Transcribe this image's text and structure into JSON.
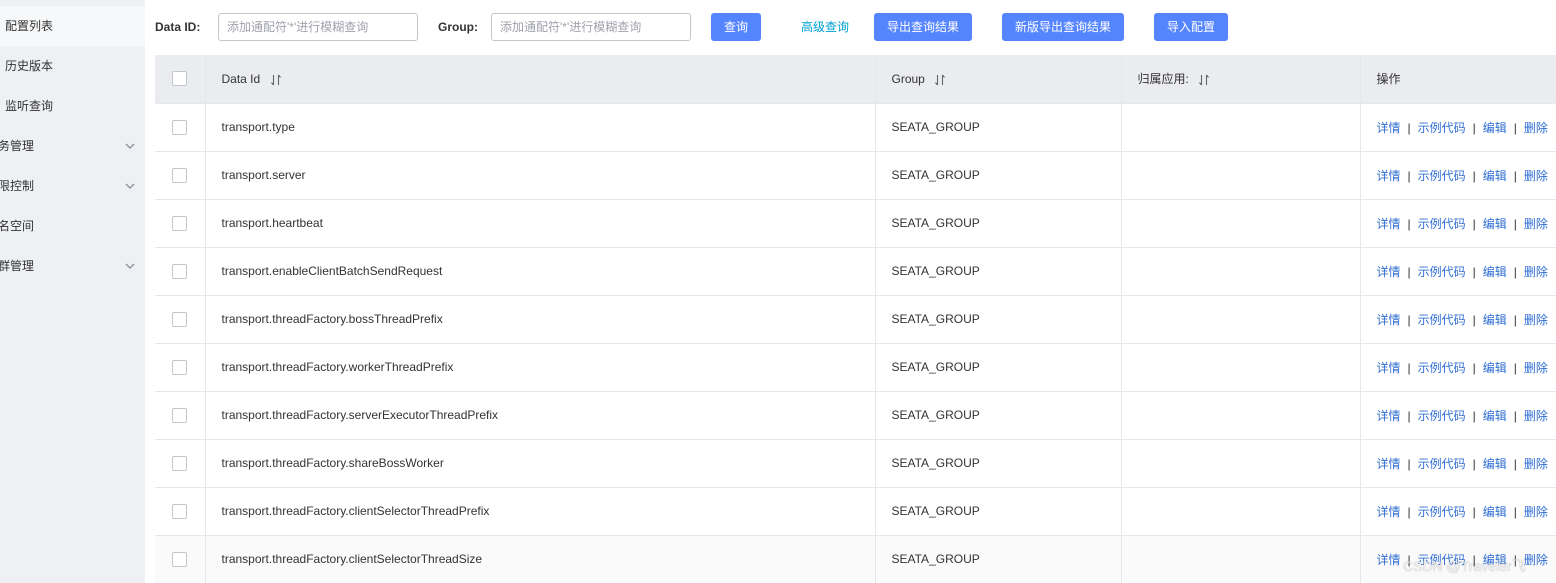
{
  "sidebar": {
    "items": [
      {
        "label": "配置列表",
        "active": true
      },
      {
        "label": "历史版本"
      },
      {
        "label": "监听查询"
      },
      {
        "label": "务管理",
        "expandable": true
      },
      {
        "label": "限控制",
        "expandable": true
      },
      {
        "label": "名空间"
      },
      {
        "label": "群管理",
        "expandable": true
      }
    ]
  },
  "search": {
    "data_id_label": "Data ID:",
    "data_id_placeholder": "添加通配符'*'进行模糊查询",
    "group_label": "Group:",
    "group_placeholder": "添加通配符'*'进行模糊查询",
    "query_button": "查询",
    "advanced_link": "高级查询",
    "export_button": "导出查询结果",
    "new_export_button": "新版导出查询结果",
    "import_button": "导入配置"
  },
  "table": {
    "headers": {
      "data_id": "Data Id",
      "group": "Group",
      "app": "归属应用:",
      "ops": "操作"
    },
    "rows": [
      {
        "data_id": "transport.type",
        "group": "SEATA_GROUP",
        "app": ""
      },
      {
        "data_id": "transport.server",
        "group": "SEATA_GROUP",
        "app": ""
      },
      {
        "data_id": "transport.heartbeat",
        "group": "SEATA_GROUP",
        "app": ""
      },
      {
        "data_id": "transport.enableClientBatchSendRequest",
        "group": "SEATA_GROUP",
        "app": ""
      },
      {
        "data_id": "transport.threadFactory.bossThreadPrefix",
        "group": "SEATA_GROUP",
        "app": ""
      },
      {
        "data_id": "transport.threadFactory.workerThreadPrefix",
        "group": "SEATA_GROUP",
        "app": ""
      },
      {
        "data_id": "transport.threadFactory.serverExecutorThreadPrefix",
        "group": "SEATA_GROUP",
        "app": ""
      },
      {
        "data_id": "transport.threadFactory.shareBossWorker",
        "group": "SEATA_GROUP",
        "app": ""
      },
      {
        "data_id": "transport.threadFactory.clientSelectorThreadPrefix",
        "group": "SEATA_GROUP",
        "app": ""
      },
      {
        "data_id": "transport.threadFactory.clientSelectorThreadSize",
        "group": "SEATA_GROUP",
        "app": ""
      }
    ],
    "actions": {
      "detail": "详情",
      "sample": "示例代码",
      "edit": "编辑",
      "delete": "删除",
      "separator": "|"
    }
  },
  "watermark": "CSDN @Traveler飞",
  "colors": {
    "primary": "#5584ff",
    "link": "#2f6dd1",
    "advanced_link": "#00a0d2",
    "sidebar_bg": "#eef0f3",
    "header_bg": "#ebecf0"
  }
}
